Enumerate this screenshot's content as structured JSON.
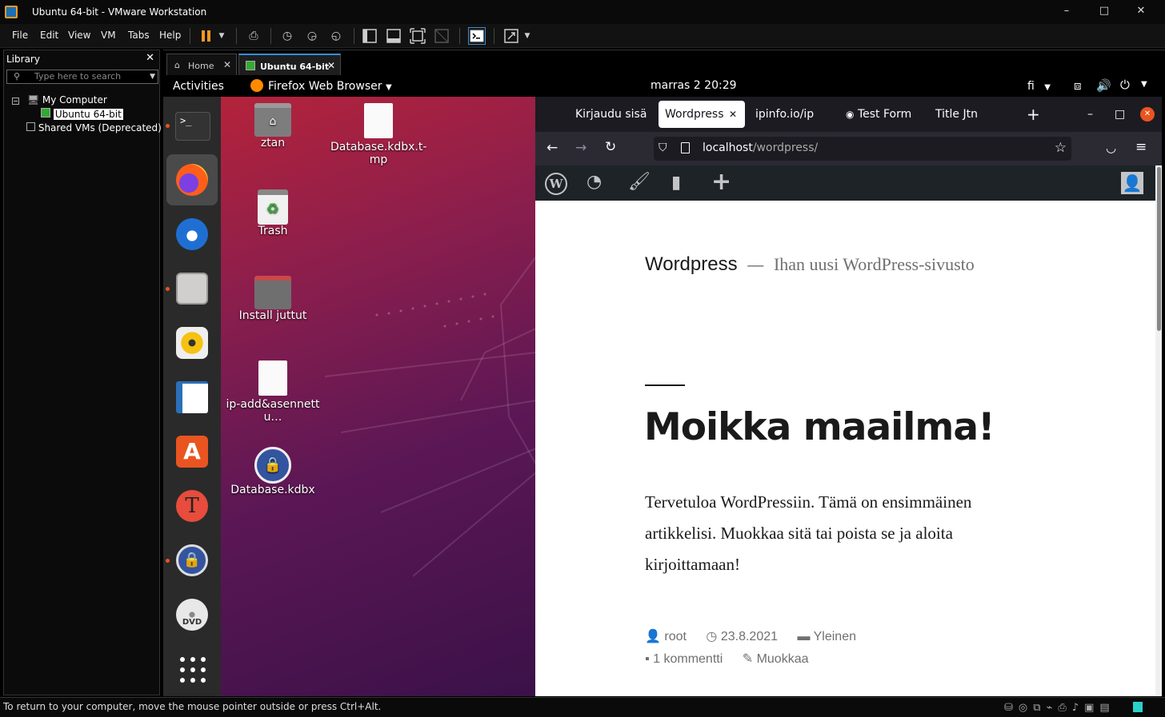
{
  "window": {
    "title": "Ubuntu 64-bit - VMware Workstation"
  },
  "menu": [
    "File",
    "Edit",
    "View",
    "VM",
    "Tabs",
    "Help"
  ],
  "library": {
    "header": "Library",
    "search_placeholder": "Type here to search",
    "tree": {
      "root": "My Computer",
      "vm": "Ubuntu 64-bit",
      "shared": "Shared VMs (Deprecated)"
    }
  },
  "vm_tabs": [
    {
      "label": "Home"
    },
    {
      "label": "Ubuntu 64-bit"
    }
  ],
  "gnome": {
    "activities": "Activities",
    "app_menu": "Firefox Web Browser",
    "clock": "marras 2  20:29",
    "input_lang": "fi"
  },
  "desktop_icons": [
    {
      "label": "ztan"
    },
    {
      "label": "Database.kdbx.t-mp"
    },
    {
      "label": "Trash"
    },
    {
      "label": "Install juttut"
    },
    {
      "label": "ip-add&asennettu…"
    },
    {
      "label": "Database.kdbx"
    }
  ],
  "firefox": {
    "tabs": [
      "Kirjaudu sisää",
      "Wordpress",
      "ipinfo.io/ip",
      "Test Form",
      "Title Jtn"
    ],
    "url_host": "localhost",
    "url_path": "/wordpress/"
  },
  "wordpress": {
    "site_title": "Wordpress",
    "separator": "—",
    "tagline": "Ihan uusi WordPress-sivusto",
    "post_title": "Moikka maailma!",
    "post_body": "Tervetuloa WordPressiin. Tämä on ensimmäinen artikkelisi. Muokkaa sitä tai poista se ja aloita kirjoittamaan!",
    "meta": {
      "author": "root",
      "date": "23.8.2021",
      "category": "Yleinen",
      "comments": "1 kommentti",
      "edit": "Muokkaa"
    }
  },
  "status": {
    "message": "To return to your computer, move the mouse pointer outside or press Ctrl+Alt."
  },
  "colors": {
    "ubuntu_orange": "#e95420",
    "wp_admin": "#1d2327",
    "vmware_accent": "#f39a1f"
  }
}
